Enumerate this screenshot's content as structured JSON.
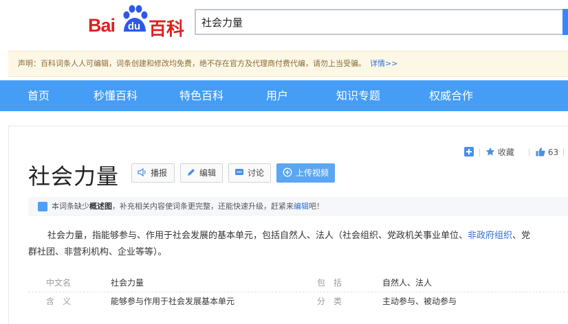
{
  "header": {
    "logo": {
      "bai": "Bai",
      "du": "du",
      "baike": "百科"
    },
    "search": {
      "value": "社会力量"
    }
  },
  "notice": {
    "text": "声明：百科词条人人可编辑，词条创建和修改均免费，绝不存在官方及代理商付费代编，请勿上当受骗。",
    "link": "详情>>"
  },
  "nav": {
    "items": [
      "首页",
      "秒懂百科",
      "特色百科",
      "用户",
      "知识专题",
      "权威合作"
    ]
  },
  "tools": {
    "favorite_label": "收藏",
    "like_count": "63"
  },
  "entry": {
    "title": "社会力量",
    "buttons": {
      "play": "播报",
      "edit": "编辑",
      "discuss": "讨论",
      "upload_video": "上传视频"
    }
  },
  "tip": {
    "prefix": "本词条缺少",
    "bold": "概述图",
    "middle": "，补充相关内容使词条更完整，还能快速升级，赶紧来",
    "link": "编辑",
    "suffix": "吧！"
  },
  "summary": {
    "line1_before": "社会力量，指能够参与、作用于社会发展的基本单元，包括自然人、法人（社会组织、党政机关事业单位、",
    "line1_link": "非政府组织",
    "line1_after": "、党",
    "line2": "群社团、非营利机构、企业等等）。"
  },
  "basic_info": {
    "rows": [
      {
        "name1": "中文名",
        "value1": "社会力量",
        "name2": "包　括",
        "value2": "自然人、法人"
      },
      {
        "name1": "含　义",
        "value1": "能够参与作用于社会发展基本单元",
        "name2": "分　类",
        "value2": "主动参与、被动参与"
      }
    ]
  },
  "colors": {
    "brand_red": "#de1f1f",
    "nav_blue": "#459df5",
    "link_blue": "#2f6fd3",
    "notice_bg": "#fdf7e6"
  }
}
